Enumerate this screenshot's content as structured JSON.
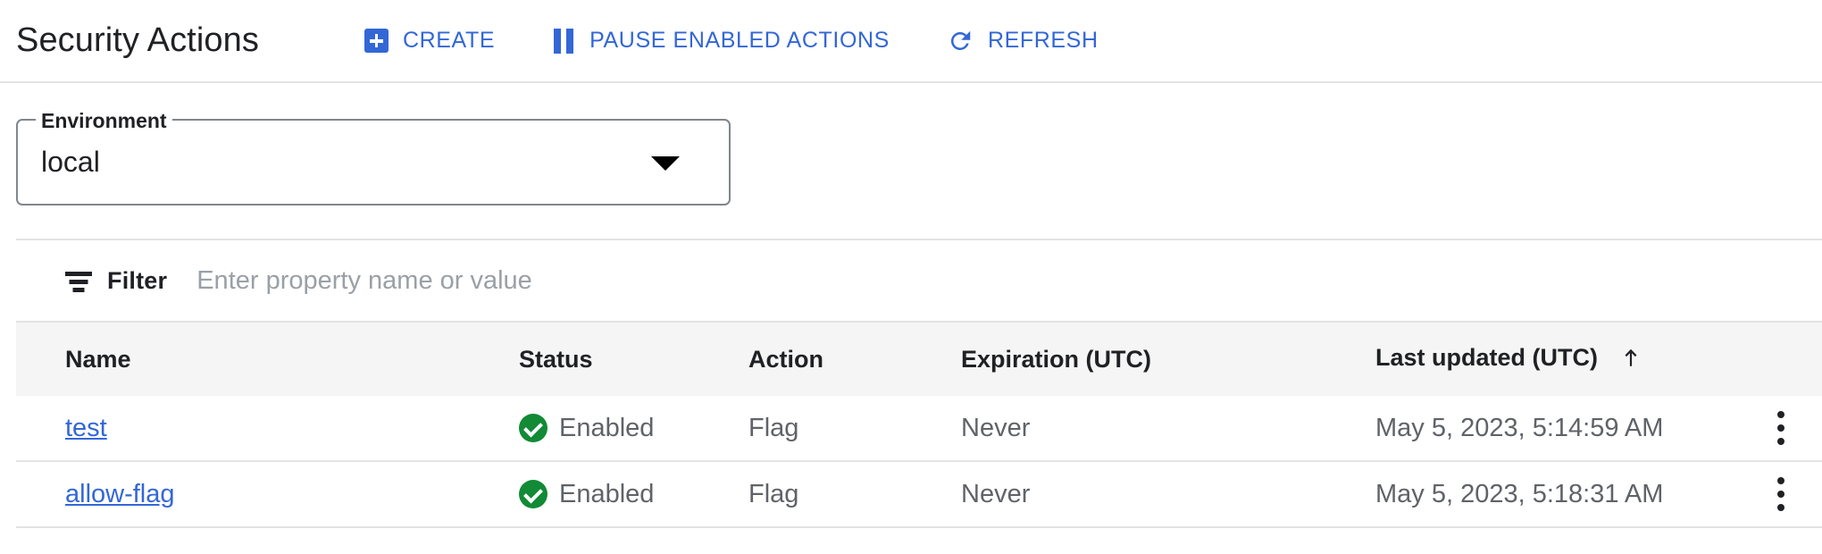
{
  "header": {
    "title": "Security Actions",
    "toolbar": [
      {
        "id": "create",
        "label": "CREATE",
        "icon": "plus-box-icon"
      },
      {
        "id": "pause",
        "label": "PAUSE ENABLED ACTIONS",
        "icon": "pause-icon"
      },
      {
        "id": "refresh",
        "label": "REFRESH",
        "icon": "refresh-icon"
      }
    ]
  },
  "environment": {
    "label": "Environment",
    "value": "local"
  },
  "filter": {
    "label": "Filter",
    "placeholder": "Enter property name or value",
    "value": ""
  },
  "table": {
    "columns": [
      {
        "key": "name",
        "label": "Name"
      },
      {
        "key": "status",
        "label": "Status"
      },
      {
        "key": "action",
        "label": "Action"
      },
      {
        "key": "expiration",
        "label": "Expiration (UTC)"
      },
      {
        "key": "last_updated",
        "label": "Last updated (UTC)"
      }
    ],
    "sort": {
      "column": "last_updated",
      "direction": "ascending",
      "glyph": "↑"
    },
    "rows": [
      {
        "name": "test",
        "status": "Enabled",
        "status_icon": "check-circle-icon",
        "action": "Flag",
        "expiration": "Never",
        "last_updated": "May 5, 2023, 5:14:59 AM",
        "menu_icon": "more-vert-icon"
      },
      {
        "name": "allow-flag",
        "status": "Enabled",
        "status_icon": "check-circle-icon",
        "action": "Flag",
        "expiration": "Never",
        "last_updated": "May 5, 2023, 5:18:31 AM",
        "menu_icon": "more-vert-icon"
      }
    ]
  },
  "colors": {
    "accent_blue": "#3367d6",
    "status_green": "#128a36",
    "text_primary": "#202124",
    "text_secondary": "#5f6368",
    "divider": "#e3e3e3",
    "header_row_bg": "#f5f5f5"
  }
}
